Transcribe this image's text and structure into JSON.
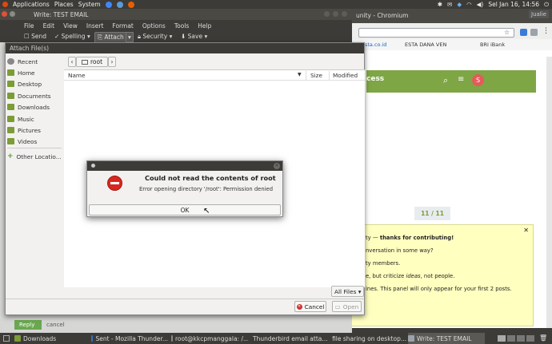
{
  "topbar": {
    "applications": "Applications",
    "places": "Places",
    "system": "System",
    "clock": "Sel Jan 16, 14:56",
    "user": "Jualie"
  },
  "chromium": {
    "title": "unity - Chromium",
    "bookmarks": [
      "sta.co.id",
      "ESTA DANA VEN",
      "BRI iBank"
    ],
    "page_heading": "cess",
    "pager": "11 / 11",
    "notice": {
      "line1_prefix": "ty —",
      "line1_bold": "thanks for contributing!",
      "line2": "nversation in some way?",
      "line3": "ty members.",
      "line4_pre": "e, but criticize",
      "line4_em": "ideas",
      "line4_post": ", not people.",
      "line5": "ines. This panel will only appear for your first 2 posts."
    }
  },
  "compose": {
    "title": "Write: TEST EMAIL",
    "menu": [
      "File",
      "Edit",
      "View",
      "Insert",
      "Format",
      "Options",
      "Tools",
      "Help"
    ],
    "toolbar": {
      "send": "Send",
      "spelling": "Spelling",
      "attach": "Attach",
      "security": "Security",
      "save": "Save"
    },
    "bottom_reply": "Reply",
    "bottom_cancel": "cancel"
  },
  "file_dialog": {
    "title": "Attach File(s)",
    "sidebar": [
      "Recent",
      "Home",
      "Desktop",
      "Documents",
      "Downloads",
      "Music",
      "Pictures",
      "Videos",
      "Other Locatio..."
    ],
    "path": "root",
    "columns": {
      "name": "Name",
      "size": "Size",
      "modified": "Modified"
    },
    "filter": "All Files",
    "cancel": "Cancel",
    "open": "Open"
  },
  "error": {
    "title": "Could not read the contents of root",
    "message": "Error opening directory '/root': Permission denied",
    "ok": "OK"
  },
  "taskbar": {
    "items": [
      "Downloads",
      "Sent - Mozilla Thunder...",
      "root@kkcpmanggala: /...",
      "Thunderbird email atta...",
      "file sharing on desktop...",
      "Write: TEST EMAIL"
    ]
  }
}
